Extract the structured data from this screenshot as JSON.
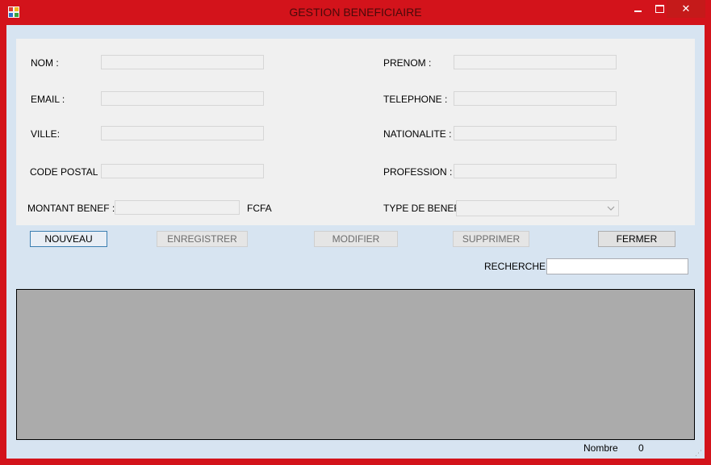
{
  "window": {
    "title": "GESTION BENEFICIAIRE",
    "controls": {
      "minimize": "–",
      "maximize": "☐",
      "close": "✕"
    }
  },
  "form": {
    "nom_label": "NOM :",
    "prenom_label": "PRENOM :",
    "email_label": "EMAIL :",
    "telephone_label": "TELEPHONE :",
    "ville_label": "VILLE:",
    "nationalite_label": "NATIONALITE :",
    "code_postal_label": "CODE POSTAL :",
    "profession_label": "PROFESSION :",
    "montant_label": "MONTANT BENEF :",
    "currency_label": "FCFA",
    "type_label": "TYPE DE BENEF:",
    "values": {
      "nom": "",
      "prenom": "",
      "email": "",
      "telephone": "",
      "ville": "",
      "nationalite": "",
      "code_postal": "",
      "profession": "",
      "montant": "",
      "type": ""
    }
  },
  "toolbar": {
    "nouveau": "NOUVEAU",
    "enregistrer": "ENREGISTRER",
    "modifier": "MODIFIER",
    "supprimer": "SUPPRIMER",
    "fermer": "FERMER"
  },
  "search": {
    "label": "RECHERCHE",
    "value": ""
  },
  "footer": {
    "count_label": "Nombre",
    "count_value": "0"
  },
  "colors": {
    "frame": "#d3131b",
    "client": "#d7e4f1",
    "panel": "#f0f0f0",
    "grid": "#ababab"
  }
}
